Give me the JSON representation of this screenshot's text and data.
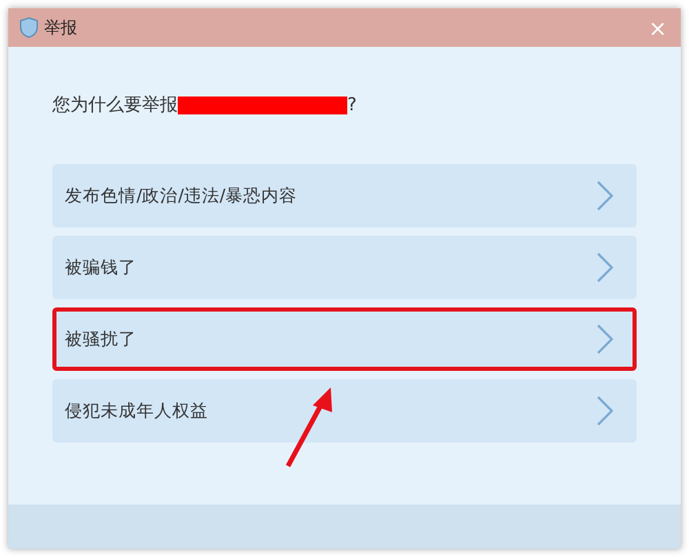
{
  "window": {
    "title": "举报",
    "close": "×"
  },
  "question": {
    "prefix": "您为什么要举报",
    "redacted": true,
    "suffix": "?"
  },
  "options": [
    {
      "label": "发布色情/政治/违法/暴恐内容",
      "highlighted": false
    },
    {
      "label": "被骗钱了",
      "highlighted": false
    },
    {
      "label": "被骚扰了",
      "highlighted": true
    },
    {
      "label": "侵犯未成年人权益",
      "highlighted": false
    }
  ]
}
